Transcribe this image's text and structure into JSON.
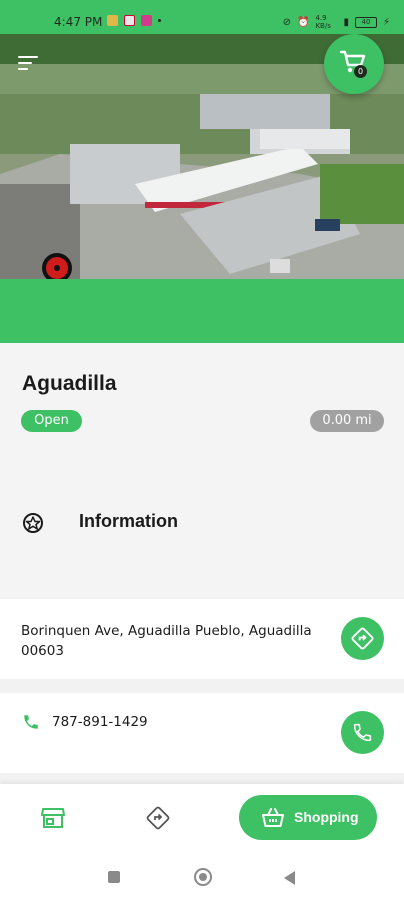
{
  "status_bar": {
    "time": "4:47 PM",
    "network_label": "4.9 KB/s",
    "battery": "40"
  },
  "header": {
    "cart_count": "0"
  },
  "store": {
    "name": "Aguadilla",
    "status": "Open",
    "distance": "0.00 mi"
  },
  "section": {
    "title": "Information"
  },
  "contact": {
    "address": "Borinquen Ave, Aguadilla Pueblo, Aguadilla 00603",
    "phone": "787-891-1429"
  },
  "bottom_nav": {
    "shopping_label": "Shopping"
  },
  "icons": [
    "menu-icon",
    "cart-icon",
    "info-icon",
    "directions-icon",
    "phone-icon",
    "store-icon",
    "route-icon",
    "basket-icon"
  ],
  "colors": {
    "accent": "#3ec064",
    "badge_gray": "#a1a1a1",
    "text": "#1b1b1b"
  }
}
